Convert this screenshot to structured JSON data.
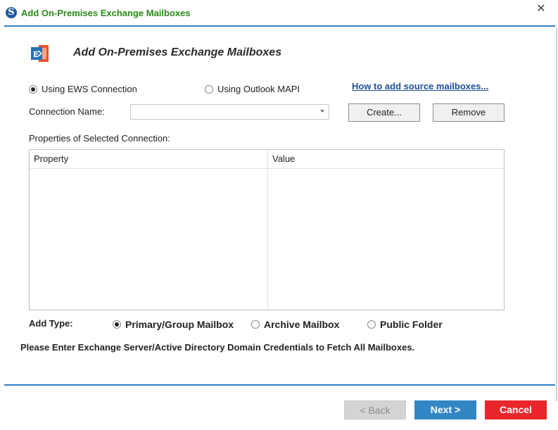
{
  "window": {
    "title": "Add On-Premises Exchange Mailboxes",
    "app_icon_letter": "S"
  },
  "header": {
    "title": "Add On-Premises Exchange Mailboxes",
    "icon": "exchange-icon"
  },
  "connection_method": {
    "options": [
      {
        "label": "Using EWS Connection",
        "selected": true
      },
      {
        "label": "Using Outlook MAPI",
        "selected": false
      }
    ],
    "help_link": "How to add source mailboxes..."
  },
  "connection": {
    "label": "Connection Name:",
    "value": "",
    "create_label": "Create...",
    "remove_label": "Remove"
  },
  "properties": {
    "label": "Properties of Selected Connection:",
    "columns": [
      "Property",
      "Value"
    ],
    "rows": []
  },
  "add_type": {
    "label": "Add Type:",
    "options": [
      {
        "label": "Primary/Group Mailbox",
        "selected": true
      },
      {
        "label": "Archive Mailbox",
        "selected": false
      },
      {
        "label": "Public Folder",
        "selected": false
      }
    ]
  },
  "notice": "Please Enter Exchange Server/Active Directory Domain Credentials to Fetch All Mailboxes.",
  "footer": {
    "back_label": "< Back",
    "next_label": "Next >",
    "cancel_label": "Cancel"
  },
  "colors": {
    "accent": "#2f7fc0",
    "title_green": "#2a8a1a",
    "next_blue": "#3386c4",
    "cancel_red": "#e8262b"
  }
}
